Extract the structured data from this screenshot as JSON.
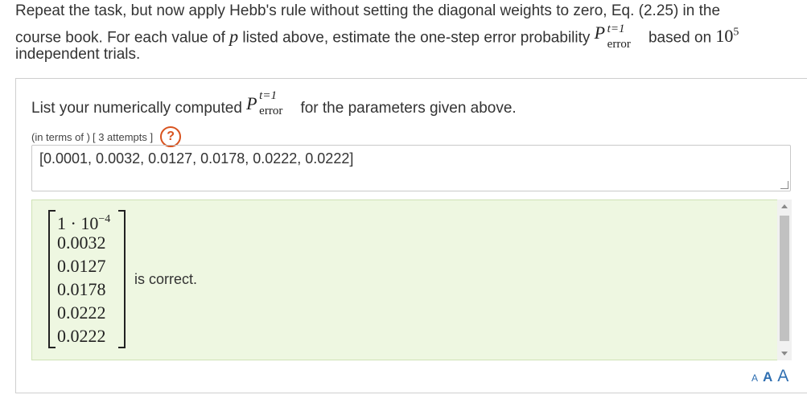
{
  "intro": {
    "line1": "Repeat the task, but now apply Hebb's rule without setting the diagonal weights to zero, Eq. (2.25) in the",
    "line2_pre": "course book. For each value of ",
    "line2_var": "p",
    "line2_mid": " listed above, estimate the one-step error probability ",
    "line2_post": " based on ",
    "trials_base": "10",
    "trials_exp": "5",
    "line3": "independent trials."
  },
  "symbol": {
    "P": "P",
    "sup": "t=1",
    "sub": "error"
  },
  "question": {
    "prompt_pre": "List your numerically computed ",
    "prompt_post": " for the parameters given above.",
    "hint_terms": "(in terms of )",
    "attempts": "[ 3 attempts ]",
    "help_icon": "?",
    "answer_value": "[0.0001, 0.0032, 0.0127, 0.0178, 0.0222, 0.0222]"
  },
  "feedback": {
    "matrix": {
      "first_mantissa": "1 · 10",
      "first_exp": "−4",
      "rows": [
        "0.0032",
        "0.0127",
        "0.0178",
        "0.0222",
        "0.0222"
      ]
    },
    "result_text": "is correct."
  },
  "font_controls": {
    "small": "A",
    "medium": "A",
    "large": "A"
  },
  "colors": {
    "feedback_bg": "#eef7e1",
    "help_icon": "#d8531f",
    "font_control": "#2f6fb1"
  }
}
